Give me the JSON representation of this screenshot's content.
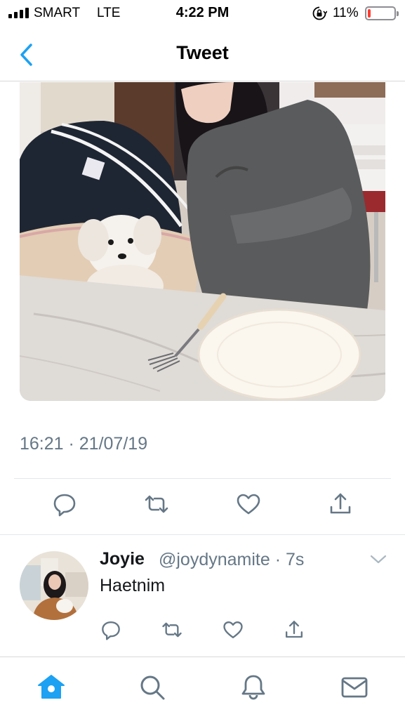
{
  "status_bar": {
    "carrier": "SMART",
    "network": "LTE",
    "time": "4:22 PM",
    "battery_percent": "11%",
    "battery_level": 0.11,
    "battery_color": "#ff3b30"
  },
  "nav": {
    "title": "Tweet",
    "back_icon": "chevron-left-icon",
    "accent": "#1da1f2"
  },
  "tweet": {
    "timestamp": "16:21 · 21/07/19",
    "actions": [
      "reply-icon",
      "retweet-icon",
      "like-icon",
      "share-icon"
    ]
  },
  "reply": {
    "name": "Joyie",
    "handle_line": "@joydynamite · 7s",
    "text": "Haetnim",
    "actions": [
      "reply-icon",
      "retweet-icon",
      "like-icon",
      "share-icon"
    ]
  },
  "tab_bar": {
    "tabs": [
      "home-icon",
      "search-icon",
      "notifications-icon",
      "messages-icon"
    ],
    "active_tab": "home-icon"
  }
}
